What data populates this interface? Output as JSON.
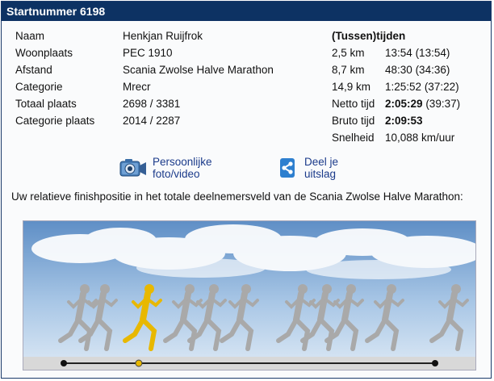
{
  "header": {
    "title": "Startnummer 6198"
  },
  "info": {
    "rows": [
      {
        "label": "Naam",
        "value": "Henkjan Ruijfrok"
      },
      {
        "label": "Woonplaats",
        "value": "PEC 1910"
      },
      {
        "label": "Afstand",
        "value": "Scania Zwolse Halve Marathon"
      },
      {
        "label": "Categorie",
        "value": "Mrecr"
      },
      {
        "label": "Totaal plaats",
        "value": "2698 / 3381"
      },
      {
        "label": "Categorie plaats",
        "value": "2014 / 2287"
      }
    ]
  },
  "times": {
    "heading": "(Tussen)tijden",
    "splits": [
      {
        "label": "2,5 km",
        "time": "13:54",
        "extra": "(13:54)"
      },
      {
        "label": "8,7 km",
        "time": "48:30",
        "extra": "(34:36)"
      },
      {
        "label": "14,9 km",
        "time": "1:25:52",
        "extra": "(37:22)"
      }
    ],
    "netto": {
      "label": "Netto tijd",
      "time": "2:05:29",
      "extra": "(39:37)"
    },
    "bruto": {
      "label": "Bruto tijd",
      "time": "2:09:53"
    },
    "speed": {
      "label": "Snelheid",
      "value": "10,088 km/uur"
    }
  },
  "actions": {
    "photo_label": "Persoonlijke foto/video",
    "photo_icon": "camera-icon",
    "share_label": "Deel je uitslag",
    "share_icon": "share-icon"
  },
  "description": "Uw relatieve finishpositie in het totale deelnemersveld van de Scania Zwolse Halve Marathon:",
  "position": {
    "overall_rank": 2698,
    "total_participants": 3381,
    "highlight_color": "#e8b800",
    "runner_color": "#a9a9a9"
  }
}
